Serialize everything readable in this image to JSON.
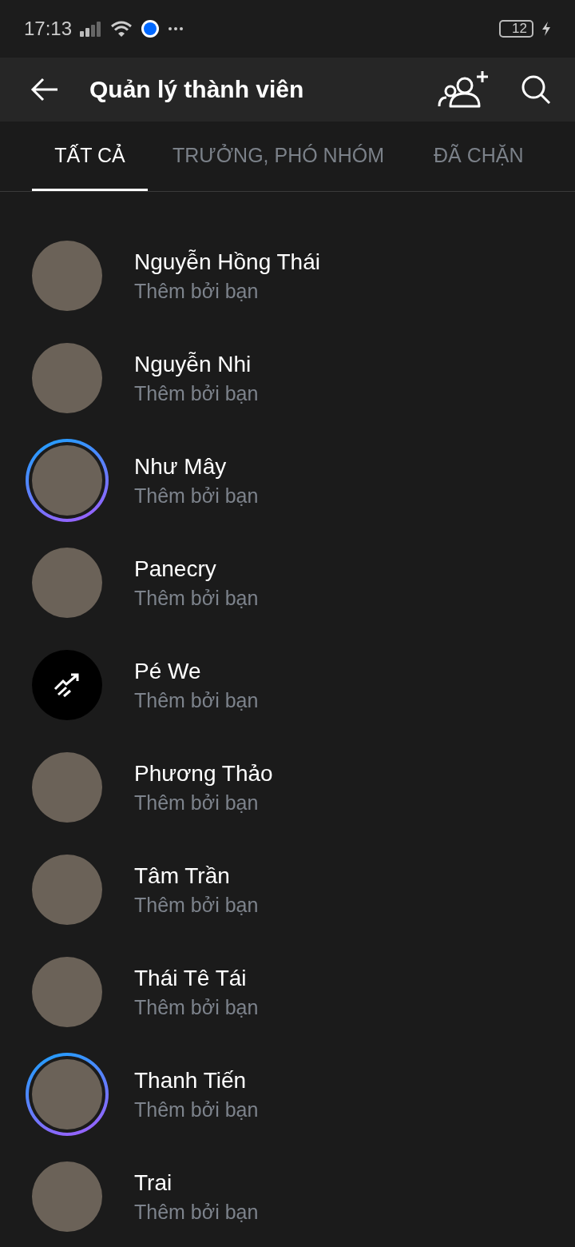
{
  "status_bar": {
    "time": "17:13",
    "battery": "12"
  },
  "header": {
    "title": "Quản lý thành viên"
  },
  "tabs": [
    {
      "label": "TẤT CẢ",
      "selected": true
    },
    {
      "label": "TRƯỞNG, PHÓ NHÓM",
      "selected": false
    },
    {
      "label": "ĐÃ CHẶN",
      "selected": false
    }
  ],
  "members": [
    {
      "name": "Nguyễn Hồng Thái",
      "subtitle": "Thêm bởi bạn",
      "kind": "photo",
      "story_ring": false
    },
    {
      "name": "Nguyễn Nhi",
      "subtitle": "Thêm bởi bạn",
      "kind": "photo",
      "story_ring": false
    },
    {
      "name": "Như Mây",
      "subtitle": "Thêm bởi bạn",
      "kind": "photo",
      "story_ring": true
    },
    {
      "name": "Panecry",
      "subtitle": "Thêm bởi bạn",
      "kind": "photo",
      "story_ring": false
    },
    {
      "name": "Pé We",
      "subtitle": "Thêm bởi bạn",
      "kind": "icon",
      "story_ring": false
    },
    {
      "name": "Phương Thảo",
      "subtitle": "Thêm bởi bạn",
      "kind": "photo",
      "story_ring": false
    },
    {
      "name": "Tâm Trần",
      "subtitle": "Thêm bởi bạn",
      "kind": "photo",
      "story_ring": false
    },
    {
      "name": "Thái Tê Tái",
      "subtitle": "Thêm bởi bạn",
      "kind": "photo",
      "story_ring": false
    },
    {
      "name": "Thanh Tiến",
      "subtitle": "Thêm bởi bạn",
      "kind": "photo",
      "story_ring": true
    },
    {
      "name": "Trai",
      "subtitle": "Thêm bởi bạn",
      "kind": "photo",
      "story_ring": false
    }
  ]
}
